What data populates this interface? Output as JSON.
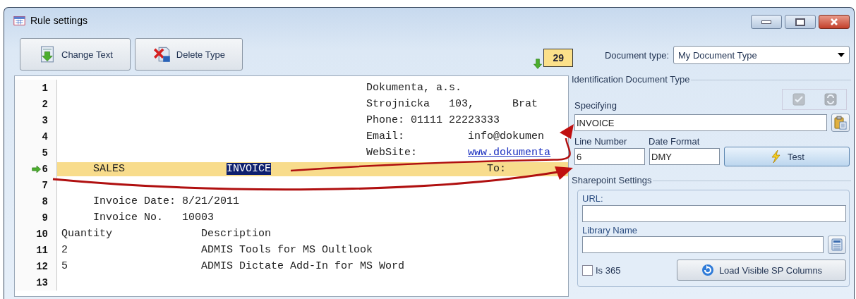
{
  "window": {
    "title": "Rule settings"
  },
  "toolbar": {
    "buttons": [
      {
        "label": "Change Text",
        "kind": "change"
      },
      {
        "label": "Delete Type",
        "kind": "delete"
      }
    ],
    "counter": "29"
  },
  "editor": {
    "lines": [
      {
        "number": "1",
        "current": false,
        "segments": [
          {
            "kind": "plain",
            "text": "                                                Dokumenta, a.s."
          }
        ]
      },
      {
        "number": "2",
        "current": false,
        "segments": [
          {
            "kind": "plain",
            "text": "                                                Strojnicka   103,      Brat"
          }
        ]
      },
      {
        "number": "3",
        "current": false,
        "segments": [
          {
            "kind": "plain",
            "text": "                                                Phone: 01111 22223333"
          }
        ]
      },
      {
        "number": "4",
        "current": false,
        "segments": [
          {
            "kind": "plain",
            "text": "                                                Email:          info@dokumen"
          }
        ]
      },
      {
        "number": "5",
        "current": false,
        "segments": [
          {
            "kind": "plain",
            "text": "                                                WebSite:        "
          },
          {
            "kind": "link",
            "text": "www.dokumenta"
          }
        ]
      },
      {
        "number": "6",
        "current": true,
        "segments": [
          {
            "kind": "plain",
            "text": "     SALES                "
          },
          {
            "kind": "selected",
            "text": "INVOICE"
          },
          {
            "kind": "plain",
            "text": "                                  To:"
          }
        ]
      },
      {
        "number": "7",
        "current": false
      },
      {
        "number": "8",
        "current": false,
        "segments": [
          {
            "kind": "plain",
            "text": "     Invoice Date: 8/21/2011"
          }
        ]
      },
      {
        "number": "9",
        "current": false,
        "segments": [
          {
            "kind": "plain",
            "text": "     Invoice No.   10003"
          }
        ]
      },
      {
        "number": "10",
        "current": false,
        "segments": [
          {
            "kind": "plain",
            "text": "Quantity              Description"
          }
        ]
      },
      {
        "number": "11",
        "current": false,
        "segments": [
          {
            "kind": "plain",
            "text": "2                     ADMIS Tools for MS Oultlook"
          }
        ]
      },
      {
        "number": "12",
        "current": false,
        "segments": [
          {
            "kind": "plain",
            "text": "5                     ADMIS Dictate Add-In for MS Word"
          }
        ]
      },
      {
        "number": "13",
        "current": false
      }
    ]
  },
  "document_type": {
    "label": "Document type:",
    "value": "My Document Type"
  },
  "identification": {
    "title": "Identification Document Type",
    "header_buttons": [
      {
        "kind": "confirm",
        "disabled": true
      },
      {
        "kind": "refresh",
        "disabled": true
      }
    ],
    "specifying_label": "Specifying",
    "specifying_value": "INVOICE",
    "line_number_label": "Line Number",
    "line_number_value": "6",
    "date_format_label": "Date Format",
    "date_format_value": "DMY",
    "test_button": "Test"
  },
  "sharepoint": {
    "title": "Sharepoint Settings",
    "url_label": "URL:",
    "library_label": "Library Name",
    "is365": {
      "label": "Is 365",
      "checked": false
    },
    "load_button": "Load Visible SP Columns"
  }
}
